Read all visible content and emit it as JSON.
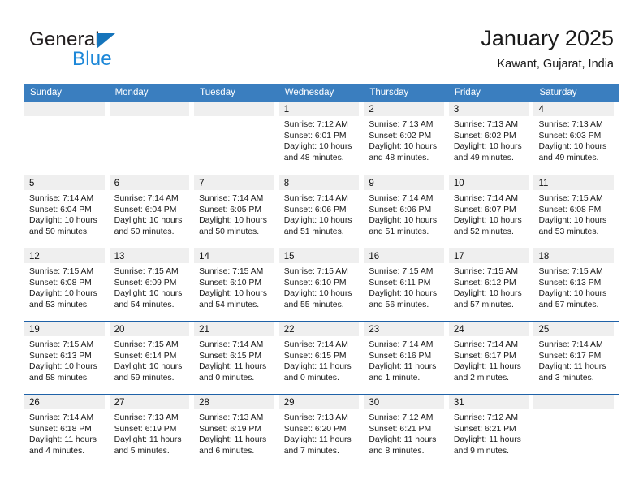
{
  "brand": {
    "name_part1": "General",
    "name_part2": "Blue",
    "triangle_icon": "triangle-logo-icon",
    "accent_dark": "#231f20",
    "accent_blue": "#1c87d8",
    "triangle_color": "#1574bb"
  },
  "header": {
    "title": "January 2025",
    "subtitle": "Kawant, Gujarat, India"
  },
  "colors": {
    "header_row_bg": "#3a7ebf",
    "header_row_text": "#ffffff",
    "week_separator": "#1f62a8",
    "daynum_band_bg": "#efefef",
    "cell_bg": "#ffffff",
    "text": "#1a1a1a"
  },
  "weekday_headers": [
    "Sunday",
    "Monday",
    "Tuesday",
    "Wednesday",
    "Thursday",
    "Friday",
    "Saturday"
  ],
  "labels": {
    "sunrise_prefix": "Sunrise:",
    "sunset_prefix": "Sunset:",
    "daylight_prefix": "Daylight:"
  },
  "weeks": [
    [
      {
        "day": "",
        "lines": []
      },
      {
        "day": "",
        "lines": []
      },
      {
        "day": "",
        "lines": []
      },
      {
        "day": "1",
        "lines": [
          "Sunrise: 7:12 AM",
          "Sunset: 6:01 PM",
          "Daylight: 10 hours",
          "and 48 minutes."
        ]
      },
      {
        "day": "2",
        "lines": [
          "Sunrise: 7:13 AM",
          "Sunset: 6:02 PM",
          "Daylight: 10 hours",
          "and 48 minutes."
        ]
      },
      {
        "day": "3",
        "lines": [
          "Sunrise: 7:13 AM",
          "Sunset: 6:02 PM",
          "Daylight: 10 hours",
          "and 49 minutes."
        ]
      },
      {
        "day": "4",
        "lines": [
          "Sunrise: 7:13 AM",
          "Sunset: 6:03 PM",
          "Daylight: 10 hours",
          "and 49 minutes."
        ]
      }
    ],
    [
      {
        "day": "5",
        "lines": [
          "Sunrise: 7:14 AM",
          "Sunset: 6:04 PM",
          "Daylight: 10 hours",
          "and 50 minutes."
        ]
      },
      {
        "day": "6",
        "lines": [
          "Sunrise: 7:14 AM",
          "Sunset: 6:04 PM",
          "Daylight: 10 hours",
          "and 50 minutes."
        ]
      },
      {
        "day": "7",
        "lines": [
          "Sunrise: 7:14 AM",
          "Sunset: 6:05 PM",
          "Daylight: 10 hours",
          "and 50 minutes."
        ]
      },
      {
        "day": "8",
        "lines": [
          "Sunrise: 7:14 AM",
          "Sunset: 6:06 PM",
          "Daylight: 10 hours",
          "and 51 minutes."
        ]
      },
      {
        "day": "9",
        "lines": [
          "Sunrise: 7:14 AM",
          "Sunset: 6:06 PM",
          "Daylight: 10 hours",
          "and 51 minutes."
        ]
      },
      {
        "day": "10",
        "lines": [
          "Sunrise: 7:14 AM",
          "Sunset: 6:07 PM",
          "Daylight: 10 hours",
          "and 52 minutes."
        ]
      },
      {
        "day": "11",
        "lines": [
          "Sunrise: 7:15 AM",
          "Sunset: 6:08 PM",
          "Daylight: 10 hours",
          "and 53 minutes."
        ]
      }
    ],
    [
      {
        "day": "12",
        "lines": [
          "Sunrise: 7:15 AM",
          "Sunset: 6:08 PM",
          "Daylight: 10 hours",
          "and 53 minutes."
        ]
      },
      {
        "day": "13",
        "lines": [
          "Sunrise: 7:15 AM",
          "Sunset: 6:09 PM",
          "Daylight: 10 hours",
          "and 54 minutes."
        ]
      },
      {
        "day": "14",
        "lines": [
          "Sunrise: 7:15 AM",
          "Sunset: 6:10 PM",
          "Daylight: 10 hours",
          "and 54 minutes."
        ]
      },
      {
        "day": "15",
        "lines": [
          "Sunrise: 7:15 AM",
          "Sunset: 6:10 PM",
          "Daylight: 10 hours",
          "and 55 minutes."
        ]
      },
      {
        "day": "16",
        "lines": [
          "Sunrise: 7:15 AM",
          "Sunset: 6:11 PM",
          "Daylight: 10 hours",
          "and 56 minutes."
        ]
      },
      {
        "day": "17",
        "lines": [
          "Sunrise: 7:15 AM",
          "Sunset: 6:12 PM",
          "Daylight: 10 hours",
          "and 57 minutes."
        ]
      },
      {
        "day": "18",
        "lines": [
          "Sunrise: 7:15 AM",
          "Sunset: 6:13 PM",
          "Daylight: 10 hours",
          "and 57 minutes."
        ]
      }
    ],
    [
      {
        "day": "19",
        "lines": [
          "Sunrise: 7:15 AM",
          "Sunset: 6:13 PM",
          "Daylight: 10 hours",
          "and 58 minutes."
        ]
      },
      {
        "day": "20",
        "lines": [
          "Sunrise: 7:15 AM",
          "Sunset: 6:14 PM",
          "Daylight: 10 hours",
          "and 59 minutes."
        ]
      },
      {
        "day": "21",
        "lines": [
          "Sunrise: 7:14 AM",
          "Sunset: 6:15 PM",
          "Daylight: 11 hours",
          "and 0 minutes."
        ]
      },
      {
        "day": "22",
        "lines": [
          "Sunrise: 7:14 AM",
          "Sunset: 6:15 PM",
          "Daylight: 11 hours",
          "and 0 minutes."
        ]
      },
      {
        "day": "23",
        "lines": [
          "Sunrise: 7:14 AM",
          "Sunset: 6:16 PM",
          "Daylight: 11 hours",
          "and 1 minute."
        ]
      },
      {
        "day": "24",
        "lines": [
          "Sunrise: 7:14 AM",
          "Sunset: 6:17 PM",
          "Daylight: 11 hours",
          "and 2 minutes."
        ]
      },
      {
        "day": "25",
        "lines": [
          "Sunrise: 7:14 AM",
          "Sunset: 6:17 PM",
          "Daylight: 11 hours",
          "and 3 minutes."
        ]
      }
    ],
    [
      {
        "day": "26",
        "lines": [
          "Sunrise: 7:14 AM",
          "Sunset: 6:18 PM",
          "Daylight: 11 hours",
          "and 4 minutes."
        ]
      },
      {
        "day": "27",
        "lines": [
          "Sunrise: 7:13 AM",
          "Sunset: 6:19 PM",
          "Daylight: 11 hours",
          "and 5 minutes."
        ]
      },
      {
        "day": "28",
        "lines": [
          "Sunrise: 7:13 AM",
          "Sunset: 6:19 PM",
          "Daylight: 11 hours",
          "and 6 minutes."
        ]
      },
      {
        "day": "29",
        "lines": [
          "Sunrise: 7:13 AM",
          "Sunset: 6:20 PM",
          "Daylight: 11 hours",
          "and 7 minutes."
        ]
      },
      {
        "day": "30",
        "lines": [
          "Sunrise: 7:12 AM",
          "Sunset: 6:21 PM",
          "Daylight: 11 hours",
          "and 8 minutes."
        ]
      },
      {
        "day": "31",
        "lines": [
          "Sunrise: 7:12 AM",
          "Sunset: 6:21 PM",
          "Daylight: 11 hours",
          "and 9 minutes."
        ]
      },
      {
        "day": "",
        "lines": []
      }
    ]
  ]
}
